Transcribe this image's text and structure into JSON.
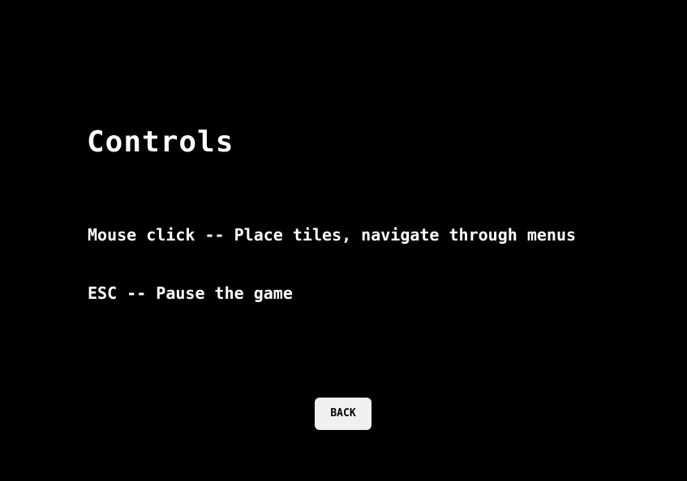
{
  "screen": {
    "title": "Controls",
    "controls": [
      {
        "text": "Mouse click -- Place tiles, navigate through menus"
      },
      {
        "text": "ESC -- Pause the game"
      }
    ],
    "back_label": "BACK"
  },
  "colors": {
    "background": "#000000",
    "text": "#ffffff",
    "button_background": "#f0f0f0",
    "button_text": "#000000"
  }
}
